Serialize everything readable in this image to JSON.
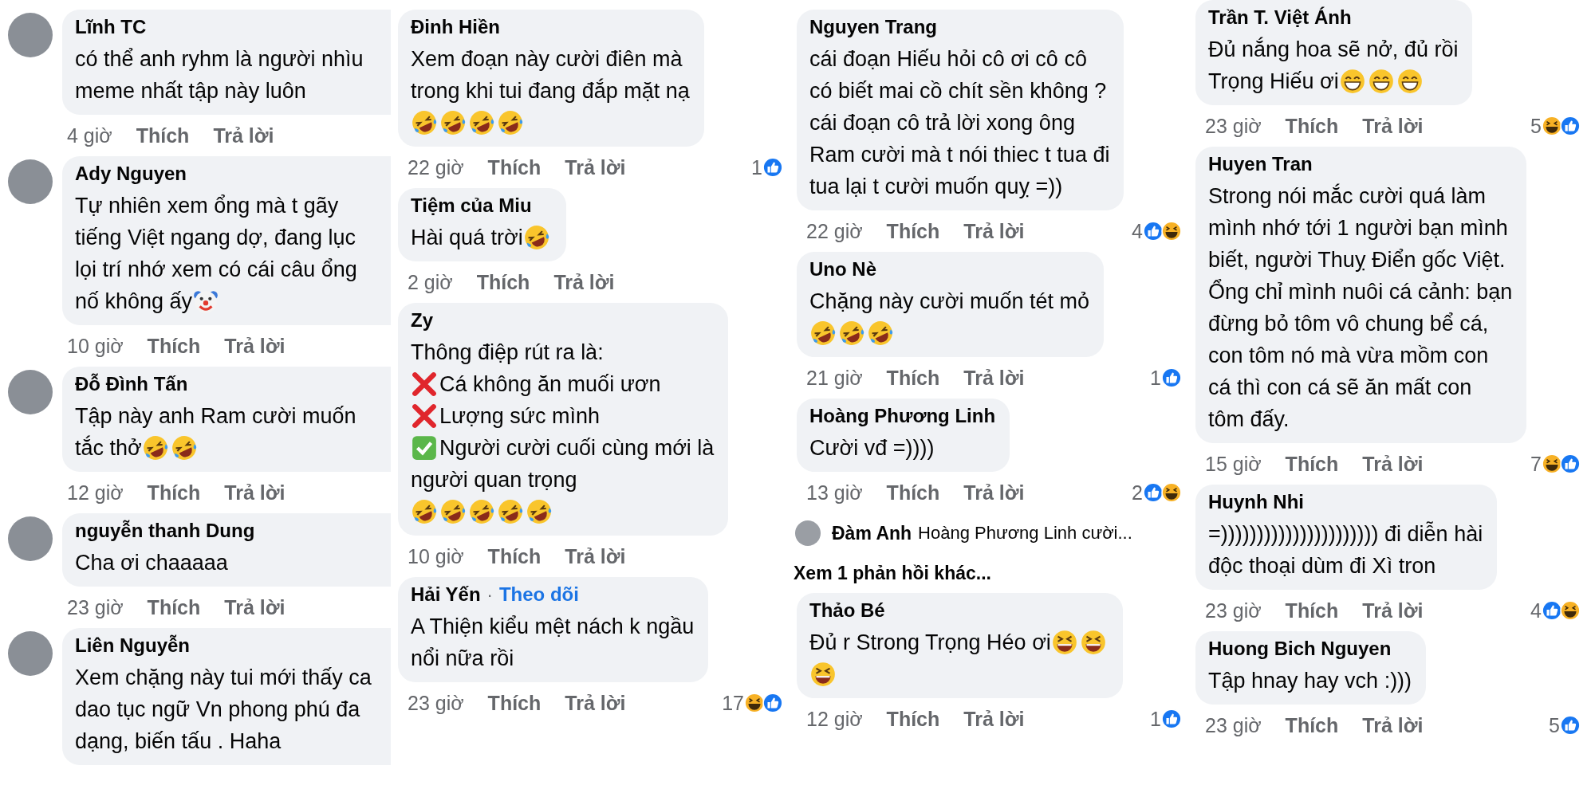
{
  "columns": [
    {
      "comments": [
        {
          "kind": "comment",
          "avatar": true,
          "name": "Lĩnh TC",
          "lines": [
            [
              {
                "kind": "text",
                "text": "có thể anh ryhm là người nhìu"
              }
            ],
            [
              {
                "kind": "text",
                "text": "meme nhất tập này luôn"
              }
            ]
          ],
          "time": "4 giờ",
          "like": "Thích",
          "reply": "Trả lời"
        },
        {
          "kind": "comment",
          "avatar": true,
          "name": "Ady Nguyen",
          "lines": [
            [
              {
                "kind": "text",
                "text": "Tự nhiên xem ổng mà t gãy"
              }
            ],
            [
              {
                "kind": "text",
                "text": "tiếng Việt ngang dợ, đang lục"
              }
            ],
            [
              {
                "kind": "text",
                "text": "lọi trí nhớ xem có cái câu ổng"
              }
            ],
            [
              {
                "kind": "text",
                "text": "nố không ấy"
              },
              {
                "kind": "clown"
              }
            ]
          ],
          "time": "10 giờ",
          "like": "Thích",
          "reply": "Trả lời"
        },
        {
          "kind": "comment",
          "avatar": true,
          "name": "Đỗ Đình Tấn",
          "lines": [
            [
              {
                "kind": "text",
                "text": "Tập này anh Ram cười muốn"
              }
            ],
            [
              {
                "kind": "text",
                "text": "tắc thở"
              },
              {
                "kind": "tears"
              },
              {
                "kind": "tears"
              }
            ]
          ],
          "time": "12 giờ",
          "like": "Thích",
          "reply": "Trả lời"
        },
        {
          "kind": "comment",
          "avatar": true,
          "name": "nguyễn thanh Dung",
          "lines": [
            [
              {
                "kind": "text",
                "text": "Cha ơi chaaaaa"
              }
            ]
          ],
          "time": "23 giờ",
          "like": "Thích",
          "reply": "Trả lời"
        },
        {
          "kind": "comment",
          "avatar": true,
          "name": "Liên Nguyễn",
          "lines": [
            [
              {
                "kind": "text",
                "text": "Xem chặng này tui mới thấy ca"
              }
            ],
            [
              {
                "kind": "text",
                "text": "dao tục ngữ Vn phong phú đa"
              }
            ],
            [
              {
                "kind": "text",
                "text": "dạng, biến tấu . Haha"
              }
            ]
          ]
        }
      ]
    },
    {
      "comments": [
        {
          "kind": "comment",
          "avatar": false,
          "name": "Đinh Hiền",
          "lines": [
            [
              {
                "kind": "text",
                "text": "Xem đoạn này cười điên mà"
              }
            ],
            [
              {
                "kind": "text",
                "text": "trong khi tui đang đắp mặt nạ"
              }
            ],
            [
              {
                "kind": "tears"
              },
              {
                "kind": "tears"
              },
              {
                "kind": "tears"
              },
              {
                "kind": "tears"
              }
            ]
          ],
          "time": "22 giờ",
          "like": "Thích",
          "reply": "Trả lời",
          "reactions": {
            "count": "1",
            "icons": [
              {
                "kind": "like"
              }
            ]
          }
        },
        {
          "kind": "comment",
          "avatar": false,
          "name": "Tiệm của Miu",
          "lines": [
            [
              {
                "kind": "text",
                "text": "Hài quá trời"
              },
              {
                "kind": "tears"
              }
            ]
          ],
          "time": "2 giờ",
          "like": "Thích",
          "reply": "Trả lời"
        },
        {
          "kind": "comment",
          "avatar": false,
          "name": "Zy",
          "lines": [
            [
              {
                "kind": "text",
                "text": "Thông điệp rút ra là:"
              }
            ],
            [
              {
                "kind": "cross"
              },
              {
                "kind": "text",
                "text": "Cá không ăn muối ươn"
              }
            ],
            [
              {
                "kind": "cross"
              },
              {
                "kind": "text",
                "text": "Lượng sức mình"
              }
            ],
            [
              {
                "kind": "check"
              },
              {
                "kind": "text",
                "text": "Người cười cuối cùng mới là"
              }
            ],
            [
              {
                "kind": "text",
                "text": "người quan trọng"
              }
            ],
            [
              {
                "kind": "tears"
              },
              {
                "kind": "tears"
              },
              {
                "kind": "tears"
              },
              {
                "kind": "tears"
              },
              {
                "kind": "tears"
              }
            ]
          ],
          "time": "10 giờ",
          "like": "Thích",
          "reply": "Trả lời"
        },
        {
          "kind": "comment",
          "avatar": false,
          "name": "Hải Yến",
          "separator": "·",
          "follow": "Theo dõi",
          "lines": [
            [
              {
                "kind": "text",
                "text": "A Thiện kiểu mệt nách k ngầu"
              }
            ],
            [
              {
                "kind": "text",
                "text": "nổi nữa rồi"
              }
            ]
          ],
          "time": "23 giờ",
          "like": "Thích",
          "reply": "Trả lời",
          "reactions": {
            "count": "17",
            "icons": [
              {
                "kind": "haha"
              },
              {
                "kind": "like"
              }
            ]
          }
        }
      ]
    },
    {
      "comments": [
        {
          "kind": "comment",
          "avatar": false,
          "name": "Nguyen Trang",
          "lines": [
            [
              {
                "kind": "text",
                "text": "cái đoạn Hiếu hỏi cô ơi cô cô"
              }
            ],
            [
              {
                "kind": "text",
                "text": "có biết mai cồ chít sền không ?"
              }
            ],
            [
              {
                "kind": "text",
                "text": "cái đoạn cô trả lời xong ông"
              }
            ],
            [
              {
                "kind": "text",
                "text": "Ram cười mà t nói thiec t tua đi"
              }
            ],
            [
              {
                "kind": "text",
                "text": "tua lại t cười muốn quỵ =))"
              }
            ]
          ],
          "time": "22 giờ",
          "like": "Thích",
          "reply": "Trả lời",
          "reactions": {
            "count": "4",
            "icons": [
              {
                "kind": "like"
              },
              {
                "kind": "haha"
              }
            ]
          }
        },
        {
          "kind": "comment",
          "avatar": false,
          "name": "Uno Nè",
          "lines": [
            [
              {
                "kind": "text",
                "text": "Chặng này cười muốn tét mỏ"
              }
            ],
            [
              {
                "kind": "tears"
              },
              {
                "kind": "tears"
              },
              {
                "kind": "tears"
              }
            ]
          ],
          "time": "21 giờ",
          "like": "Thích",
          "reply": "Trả lời",
          "reactions": {
            "count": "1",
            "icons": [
              {
                "kind": "like"
              }
            ]
          }
        },
        {
          "kind": "comment",
          "avatar": false,
          "name": "Hoàng Phương Linh",
          "lines": [
            [
              {
                "kind": "text",
                "text": "Cười vđ =))))"
              }
            ]
          ],
          "time": "13 giờ",
          "like": "Thích",
          "reply": "Trả lời",
          "reactions": {
            "count": "2",
            "icons": [
              {
                "kind": "like"
              },
              {
                "kind": "haha"
              }
            ]
          }
        },
        {
          "kind": "reply_preview",
          "name": "Đàm Anh",
          "text": "Hoàng Phương Linh cười..."
        },
        {
          "kind": "more_replies",
          "text": "Xem 1 phản hồi khác..."
        },
        {
          "kind": "comment",
          "avatar": false,
          "name": "Thảo Bé",
          "lines": [
            [
              {
                "kind": "text",
                "text": "Đủ r Strong Trọng Héo ơi"
              },
              {
                "kind": "squint"
              },
              {
                "kind": "squint"
              }
            ],
            [
              {
                "kind": "squint"
              }
            ]
          ],
          "time": "12 giờ",
          "like": "Thích",
          "reply": "Trả lời",
          "reactions": {
            "count": "1",
            "icons": [
              {
                "kind": "like"
              }
            ]
          }
        }
      ]
    },
    {
      "comments": [
        {
          "kind": "comment",
          "avatar": false,
          "name": "Trần T. Việt Ánh",
          "lines": [
            [
              {
                "kind": "text",
                "text": "Đủ nắng hoa sẽ nở, đủ rồi"
              }
            ],
            [
              {
                "kind": "text",
                "text": "Trọng Hiếu ơi"
              },
              {
                "kind": "grin"
              },
              {
                "kind": "grin"
              },
              {
                "kind": "grin"
              }
            ]
          ],
          "time": "23 giờ",
          "like": "Thích",
          "reply": "Trả lời",
          "reactions": {
            "count": "5",
            "icons": [
              {
                "kind": "haha"
              },
              {
                "kind": "like"
              }
            ]
          }
        },
        {
          "kind": "comment",
          "avatar": false,
          "name": "Huyen Tran",
          "lines": [
            [
              {
                "kind": "text",
                "text": "Strong nói mắc cười quá làm"
              }
            ],
            [
              {
                "kind": "text",
                "text": "mình nhớ tới 1 người bạn mình"
              }
            ],
            [
              {
                "kind": "text",
                "text": "biết, người Thuỵ Điển gốc Việt."
              }
            ],
            [
              {
                "kind": "text",
                "text": "Ổng chỉ mình nuôi cá cảnh: bạn"
              }
            ],
            [
              {
                "kind": "text",
                "text": "đừng bỏ tôm vô chung bể cá,"
              }
            ],
            [
              {
                "kind": "text",
                "text": "con tôm nó mà vừa mồm con"
              }
            ],
            [
              {
                "kind": "text",
                "text": "cá thì con cá sẽ ăn mất con"
              }
            ],
            [
              {
                "kind": "text",
                "text": "tôm đấy."
              }
            ]
          ],
          "time": "15 giờ",
          "like": "Thích",
          "reply": "Trả lời",
          "reactions": {
            "count": "7",
            "icons": [
              {
                "kind": "haha"
              },
              {
                "kind": "like"
              }
            ]
          }
        },
        {
          "kind": "comment",
          "avatar": false,
          "name": "Huynh Nhi",
          "lines": [
            [
              {
                "kind": "text",
                "text": "=)))))))))))))))))))))) đi diễn hài"
              }
            ],
            [
              {
                "kind": "text",
                "text": "độc thoại dùm đi Xì tron"
              }
            ]
          ],
          "time": "23 giờ",
          "like": "Thích",
          "reply": "Trả lời",
          "reactions": {
            "count": "4",
            "icons": [
              {
                "kind": "like"
              },
              {
                "kind": "haha"
              }
            ]
          }
        },
        {
          "kind": "comment",
          "avatar": false,
          "name": "Huong Bich Nguyen",
          "lines": [
            [
              {
                "kind": "text",
                "text": "Tập hnay hay vch :)))"
              }
            ]
          ],
          "time": "23 giờ",
          "like": "Thích",
          "reply": "Trả lời",
          "reactions": {
            "count": "5",
            "icons": [
              {
                "kind": "like"
              }
            ]
          }
        }
      ]
    }
  ]
}
